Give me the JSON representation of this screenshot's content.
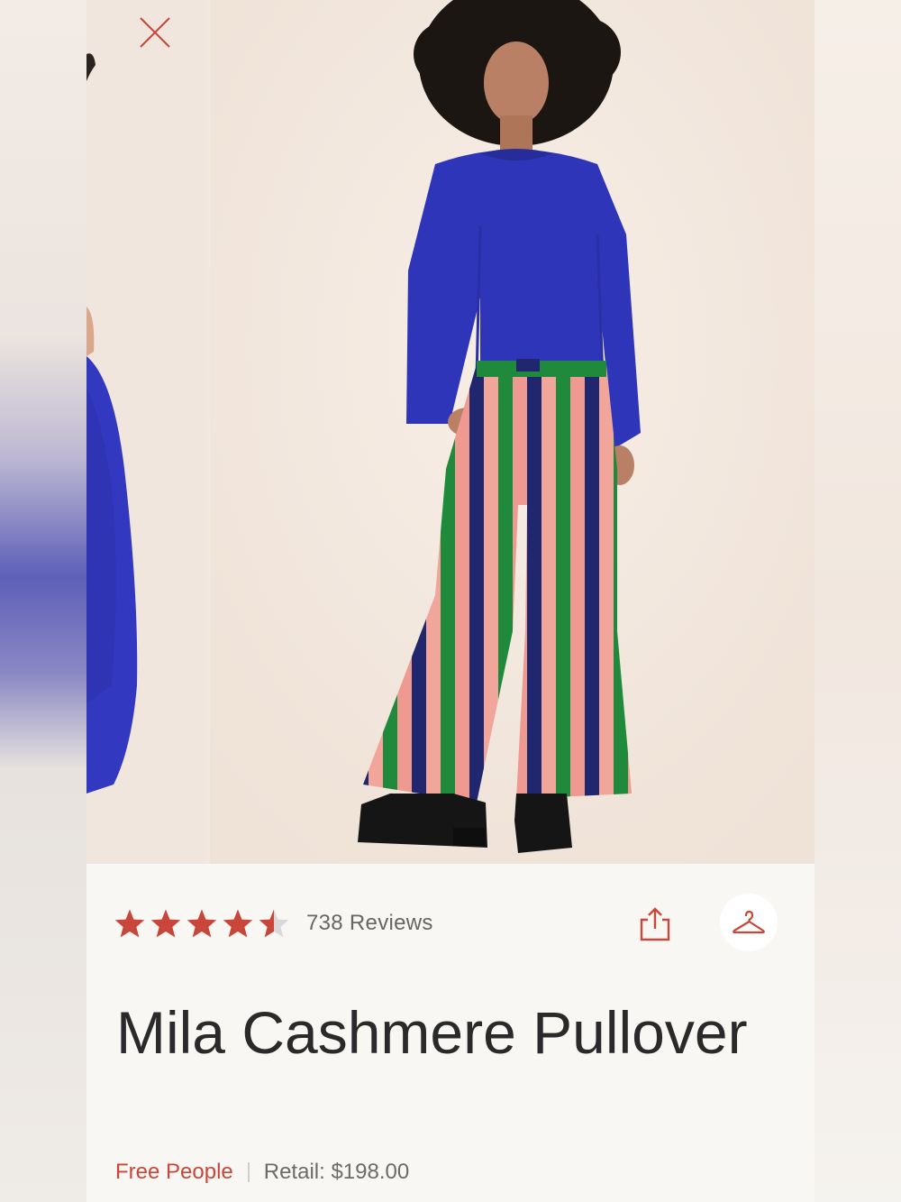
{
  "product": {
    "title": "Mila Cashmere Pullover",
    "brand": "Free People",
    "retail_label": "Retail: $198.00",
    "rating": 4.5,
    "rating_max": 5,
    "reviews_label": "738 Reviews"
  },
  "icons": {
    "close": "close-icon",
    "share": "share-icon",
    "closet": "hanger-icon"
  },
  "colors": {
    "accent": "#c8473a",
    "star_empty": "#d9d9d9",
    "sweater": "#2f35b8"
  }
}
